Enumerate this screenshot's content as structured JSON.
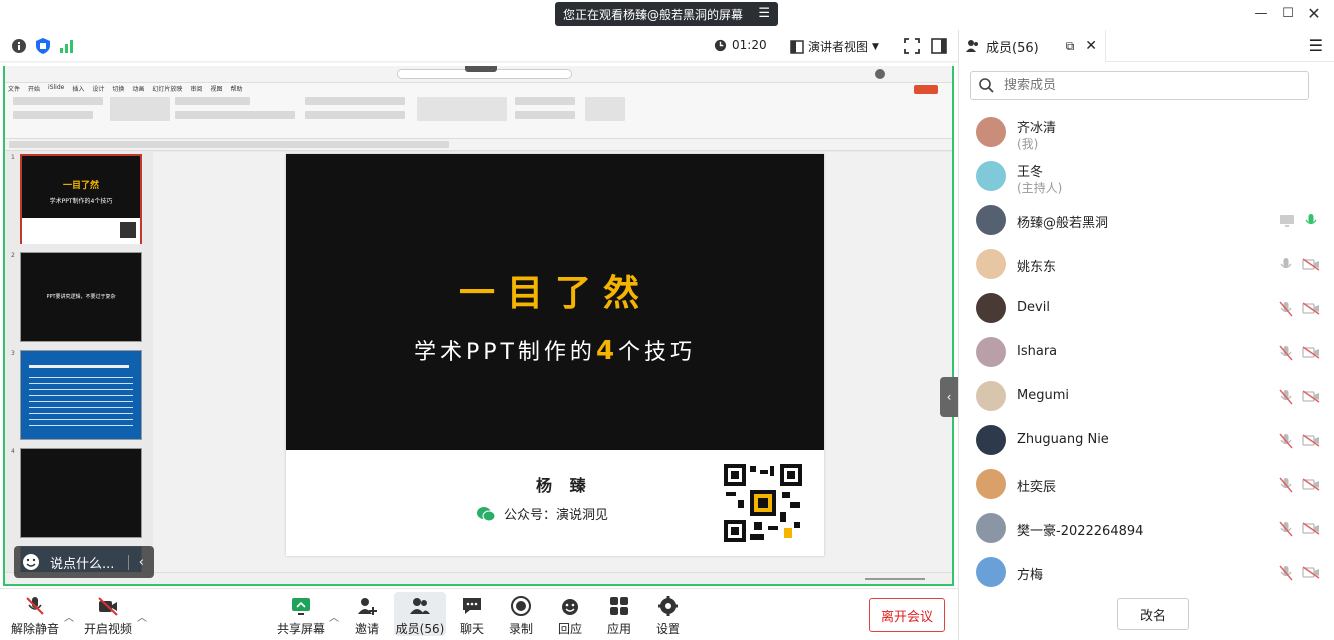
{
  "window": {
    "banner": "您正在观看杨臻@般若黑洞的屏幕",
    "minimize_icon": "minimize-icon",
    "maximize_icon": "maximize-icon",
    "close_icon": "close-icon"
  },
  "topbar": {
    "timer": "01:20",
    "view_mode": "演讲者视图"
  },
  "slide": {
    "title": "一目了然",
    "subtitle_pre": "学术PPT制作的",
    "subtitle_num": "4",
    "subtitle_post": "个技巧",
    "author": "杨 臻",
    "public_account": "公众号：演说洞见"
  },
  "chat_popup": {
    "placeholder": "说点什么..."
  },
  "bottombar": {
    "items": [
      {
        "label": "解除静音",
        "icon": "mic-muted-icon"
      },
      {
        "label": "开启视频",
        "icon": "video-off-icon"
      },
      {
        "label": "共享屏幕",
        "icon": "share-screen-icon"
      },
      {
        "label": "邀请",
        "icon": "invite-icon"
      },
      {
        "label": "成员(56)",
        "icon": "members-icon"
      },
      {
        "label": "聊天",
        "icon": "chat-icon"
      },
      {
        "label": "录制",
        "icon": "record-icon"
      },
      {
        "label": "回应",
        "icon": "reaction-icon"
      },
      {
        "label": "应用",
        "icon": "apps-icon"
      },
      {
        "label": "设置",
        "icon": "settings-icon"
      }
    ],
    "leave": "离开会议"
  },
  "panel": {
    "tab": "成员(56)",
    "search_placeholder": "搜索成员",
    "rename": "改名",
    "members": [
      {
        "name": "齐冰清",
        "role": "(我)",
        "color": "#c98d7a"
      },
      {
        "name": "王冬",
        "role": "(主持人)",
        "color": "#7fc9d8"
      },
      {
        "name": "杨臻@般若黑洞",
        "role": "",
        "color": "#556070"
      },
      {
        "name": "姚东东",
        "role": "",
        "color": "#e7c7a3"
      },
      {
        "name": "Devil",
        "role": "",
        "color": "#4a3a35"
      },
      {
        "name": "Ishara",
        "role": "",
        "color": "#b9a0a8"
      },
      {
        "name": "Megumi",
        "role": "",
        "color": "#d8c5ae"
      },
      {
        "name": "Zhuguang Nie",
        "role": "",
        "color": "#2e3a4c"
      },
      {
        "name": "杜奕辰",
        "role": "",
        "color": "#d9a06a"
      },
      {
        "name": "樊一豪-2022264894",
        "role": "",
        "color": "#8a96a5"
      },
      {
        "name": "方梅",
        "role": "",
        "color": "#6aa0d8"
      }
    ]
  },
  "colors": {
    "accent": "#34c36a",
    "slide_highlight": "#f5b400",
    "leave": "#e02020"
  }
}
